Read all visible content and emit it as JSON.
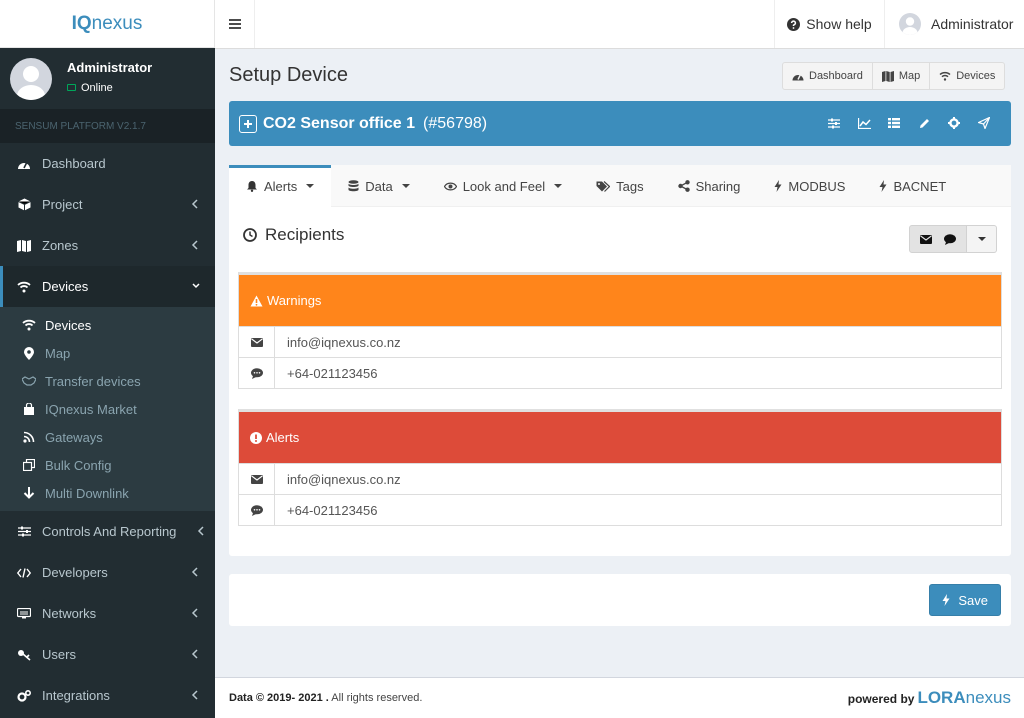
{
  "app": {
    "logo": "IQnexus",
    "platform": "SENSUM PLATFORM V2.1.7"
  },
  "user": {
    "name": "Administrator",
    "status": "Online"
  },
  "sidebar": {
    "items": [
      {
        "label": "Dashboard"
      },
      {
        "label": "Project"
      },
      {
        "label": "Zones"
      },
      {
        "label": "Devices"
      },
      {
        "label": "Controls And Reporting"
      },
      {
        "label": "Developers"
      },
      {
        "label": "Networks"
      },
      {
        "label": "Users"
      },
      {
        "label": "Integrations"
      }
    ],
    "submenu": [
      {
        "label": "Devices"
      },
      {
        "label": "Map"
      },
      {
        "label": "Transfer devices"
      },
      {
        "label": "IQnexus Market"
      },
      {
        "label": "Gateways"
      },
      {
        "label": "Bulk Config"
      },
      {
        "label": "Multi Downlink"
      }
    ]
  },
  "header": {
    "help": "Show help",
    "user": "Administrator"
  },
  "page": {
    "title": "Setup Device",
    "buttons": {
      "dashboard": "Dashboard",
      "map": "Map",
      "devices": "Devices"
    }
  },
  "device": {
    "name": "CO2 Sensor office 1",
    "id": "(#56798)"
  },
  "tabs": [
    "Alerts",
    "Data",
    "Look and Feel",
    "Tags",
    "Sharing",
    "MODBUS",
    "BACNET"
  ],
  "recipients": {
    "title": "Recipients",
    "warnings": {
      "title": "Warnings",
      "email": "info@iqnexus.co.nz",
      "phone": "+64-021123456"
    },
    "alerts": {
      "title": "Alerts",
      "email": "info@iqnexus.co.nz",
      "phone": "+64-021123456"
    }
  },
  "save_label": "Save",
  "footer": {
    "copyright": "Data © 2019- 2021 .",
    "rights": "All rights reserved.",
    "powered": "powered by",
    "brand_a": "LORA",
    "brand_b": "nexus"
  },
  "colors": {
    "primary": "#3c8dbc",
    "warning": "#ff851b",
    "danger": "#dd4b39",
    "sidebar": "#222d32"
  }
}
